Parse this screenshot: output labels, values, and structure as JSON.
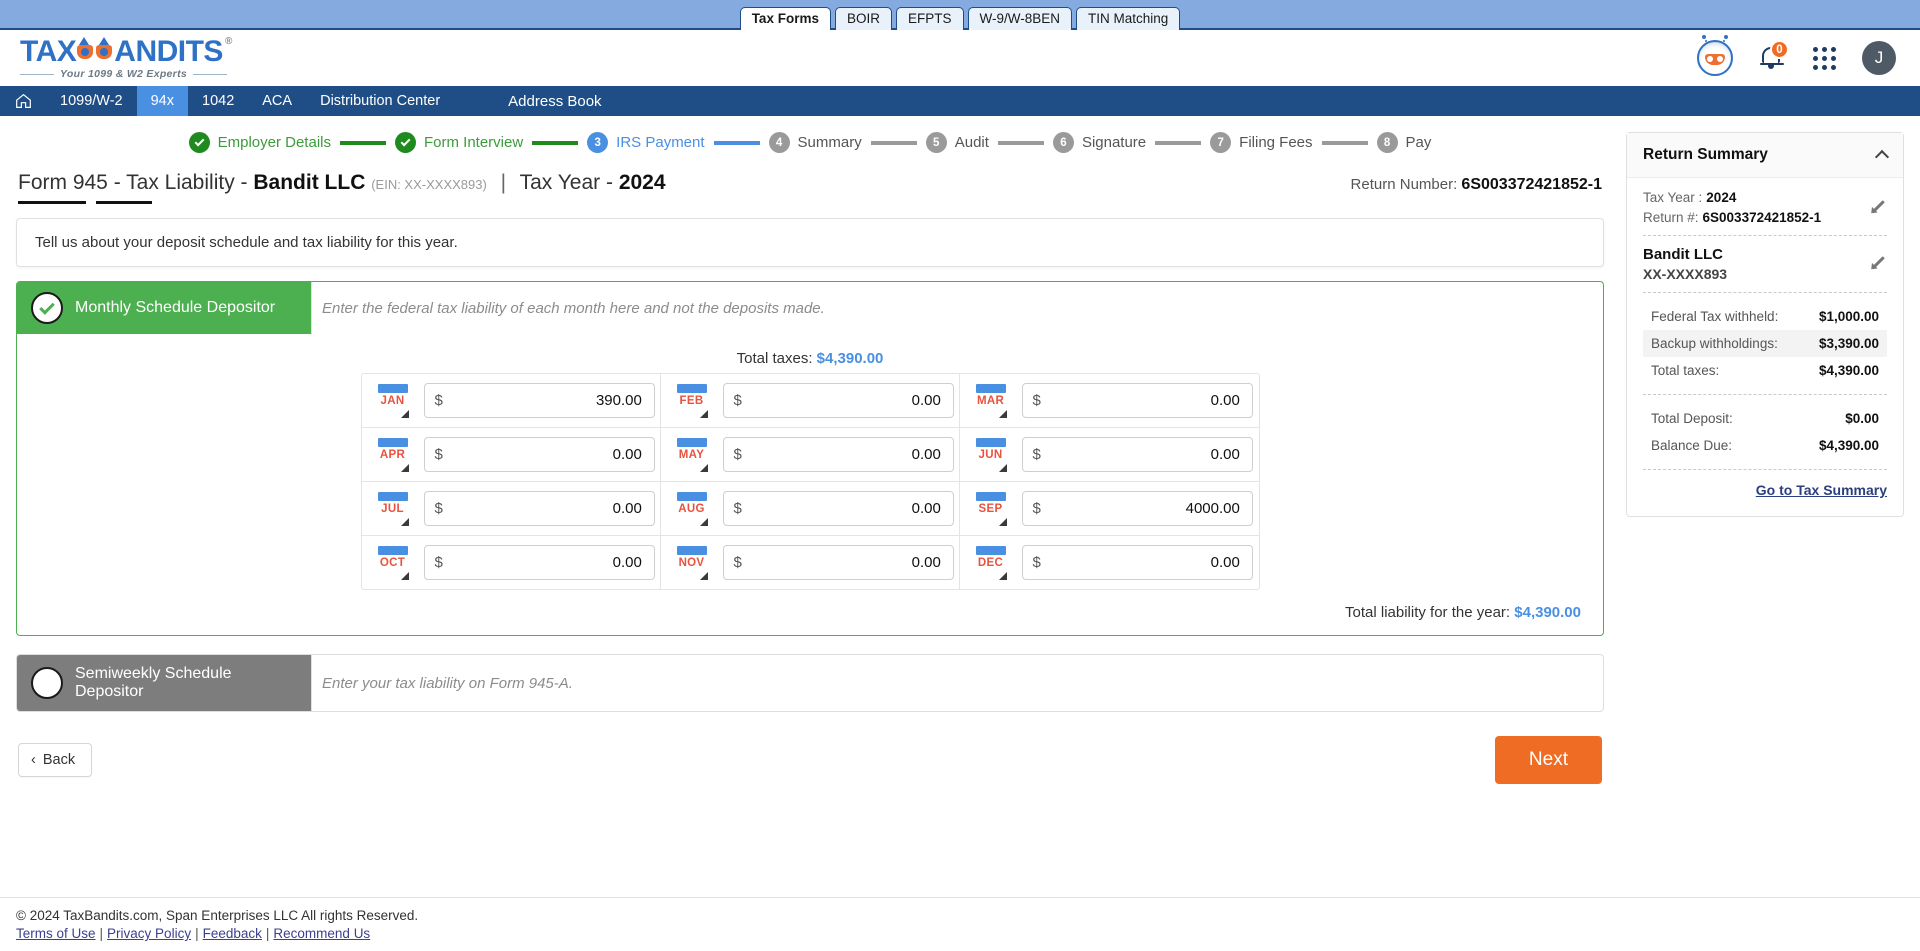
{
  "app_tabs": [
    {
      "label": "Tax Forms",
      "active": true
    },
    {
      "label": "BOIR",
      "active": false
    },
    {
      "label": "EFPTS",
      "active": false
    },
    {
      "label": "W-9/W-8BEN",
      "active": false
    },
    {
      "label": "TIN Matching",
      "active": false
    }
  ],
  "brand": {
    "name_left": "TAX",
    "name_right": "ANDITS",
    "tm": "®",
    "tagline": "Your 1099 & W2 Experts"
  },
  "header_icons": {
    "bot": "robot-assistant-icon",
    "bell": "notification-bell-icon",
    "bell_count": "0",
    "grid": "apps-grid-icon",
    "avatar_initial": "J"
  },
  "nav": {
    "home_icon": "home-icon",
    "items": [
      {
        "label": "1099/W-2",
        "active": false
      },
      {
        "label": "94x",
        "active": true
      },
      {
        "label": "1042",
        "active": false
      },
      {
        "label": "ACA",
        "active": false
      },
      {
        "label": "Distribution Center",
        "active": false
      }
    ],
    "address_book": "Address Book"
  },
  "stepper": [
    {
      "n": "1",
      "label": "Employer Details",
      "state": "done"
    },
    {
      "n": "2",
      "label": "Form Interview",
      "state": "done"
    },
    {
      "n": "3",
      "label": "IRS Payment",
      "state": "current"
    },
    {
      "n": "4",
      "label": "Summary",
      "state": "todo"
    },
    {
      "n": "5",
      "label": "Audit",
      "state": "todo"
    },
    {
      "n": "6",
      "label": "Signature",
      "state": "todo"
    },
    {
      "n": "7",
      "label": "Filing Fees",
      "state": "todo"
    },
    {
      "n": "8",
      "label": "Pay",
      "state": "todo"
    }
  ],
  "title": {
    "prefix": "Form 945 - Tax Liability",
    "dash": " - ",
    "company": "Bandit LLC",
    "ein": "(EIN: XX-XXXX893)",
    "separator": "|",
    "tax_year_label": "Tax Year - ",
    "tax_year": "2024",
    "return_number_label": "Return Number: ",
    "return_number": "6S003372421852-1"
  },
  "info_bar": "Tell us about your deposit schedule and tax liability for this year.",
  "monthly": {
    "title": "Monthly Schedule Depositor",
    "hint": "Enter the federal tax liability of each month here and not the deposits made.",
    "total_taxes_label": "Total taxes: ",
    "total_taxes_value": "$4,390.00",
    "currency": "$",
    "months": [
      {
        "abbr": "JAN",
        "value": "390.00"
      },
      {
        "abbr": "FEB",
        "value": "0.00"
      },
      {
        "abbr": "MAR",
        "value": "0.00"
      },
      {
        "abbr": "APR",
        "value": "0.00"
      },
      {
        "abbr": "MAY",
        "value": "0.00"
      },
      {
        "abbr": "JUN",
        "value": "0.00"
      },
      {
        "abbr": "JUL",
        "value": "0.00"
      },
      {
        "abbr": "AUG",
        "value": "0.00"
      },
      {
        "abbr": "SEP",
        "value": "4000.00"
      },
      {
        "abbr": "OCT",
        "value": "0.00"
      },
      {
        "abbr": "NOV",
        "value": "0.00"
      },
      {
        "abbr": "DEC",
        "value": "0.00"
      }
    ],
    "total_liability_label": "Total liability for the year: ",
    "total_liability_value": "$4,390.00"
  },
  "semiweekly": {
    "title": "Semiweekly Schedule Depositor",
    "hint": "Enter your tax liability on Form 945-A."
  },
  "buttons": {
    "back": "Back",
    "next": "Next"
  },
  "return_summary": {
    "heading": "Return Summary",
    "tax_year_label": "Tax Year :",
    "tax_year_value": "2024",
    "return_no_label": "Return #:",
    "return_no_value": "6S003372421852-1",
    "entity_name": "Bandit LLC",
    "entity_ein": "XX-XXXX893",
    "rows": [
      {
        "label": "Federal Tax withheld:",
        "value": "$1,000.00",
        "alt": false
      },
      {
        "label": "Backup withholdings:",
        "value": "$3,390.00",
        "alt": true
      },
      {
        "label": "Total taxes:",
        "value": "$4,390.00",
        "alt": false
      }
    ],
    "rows2": [
      {
        "label": "Total Deposit:",
        "value": "$0.00",
        "alt": false
      },
      {
        "label": "Balance Due:",
        "value": "$4,390.00",
        "alt": false
      }
    ],
    "link": "Go to Tax Summary"
  },
  "footer": {
    "copyright": "© 2024 TaxBandits.com, Span Enterprises LLC All rights Reserved.",
    "links": [
      "Terms of Use",
      "Privacy Policy",
      "Feedback",
      "Recommend Us"
    ],
    "divider": "|"
  },
  "colors": {
    "brand_blue": "#2f71c4",
    "nav_blue": "#1f4e87",
    "accent_orange": "#ef6c24",
    "green": "#4caf50",
    "link_blue": "#4a90e2"
  }
}
